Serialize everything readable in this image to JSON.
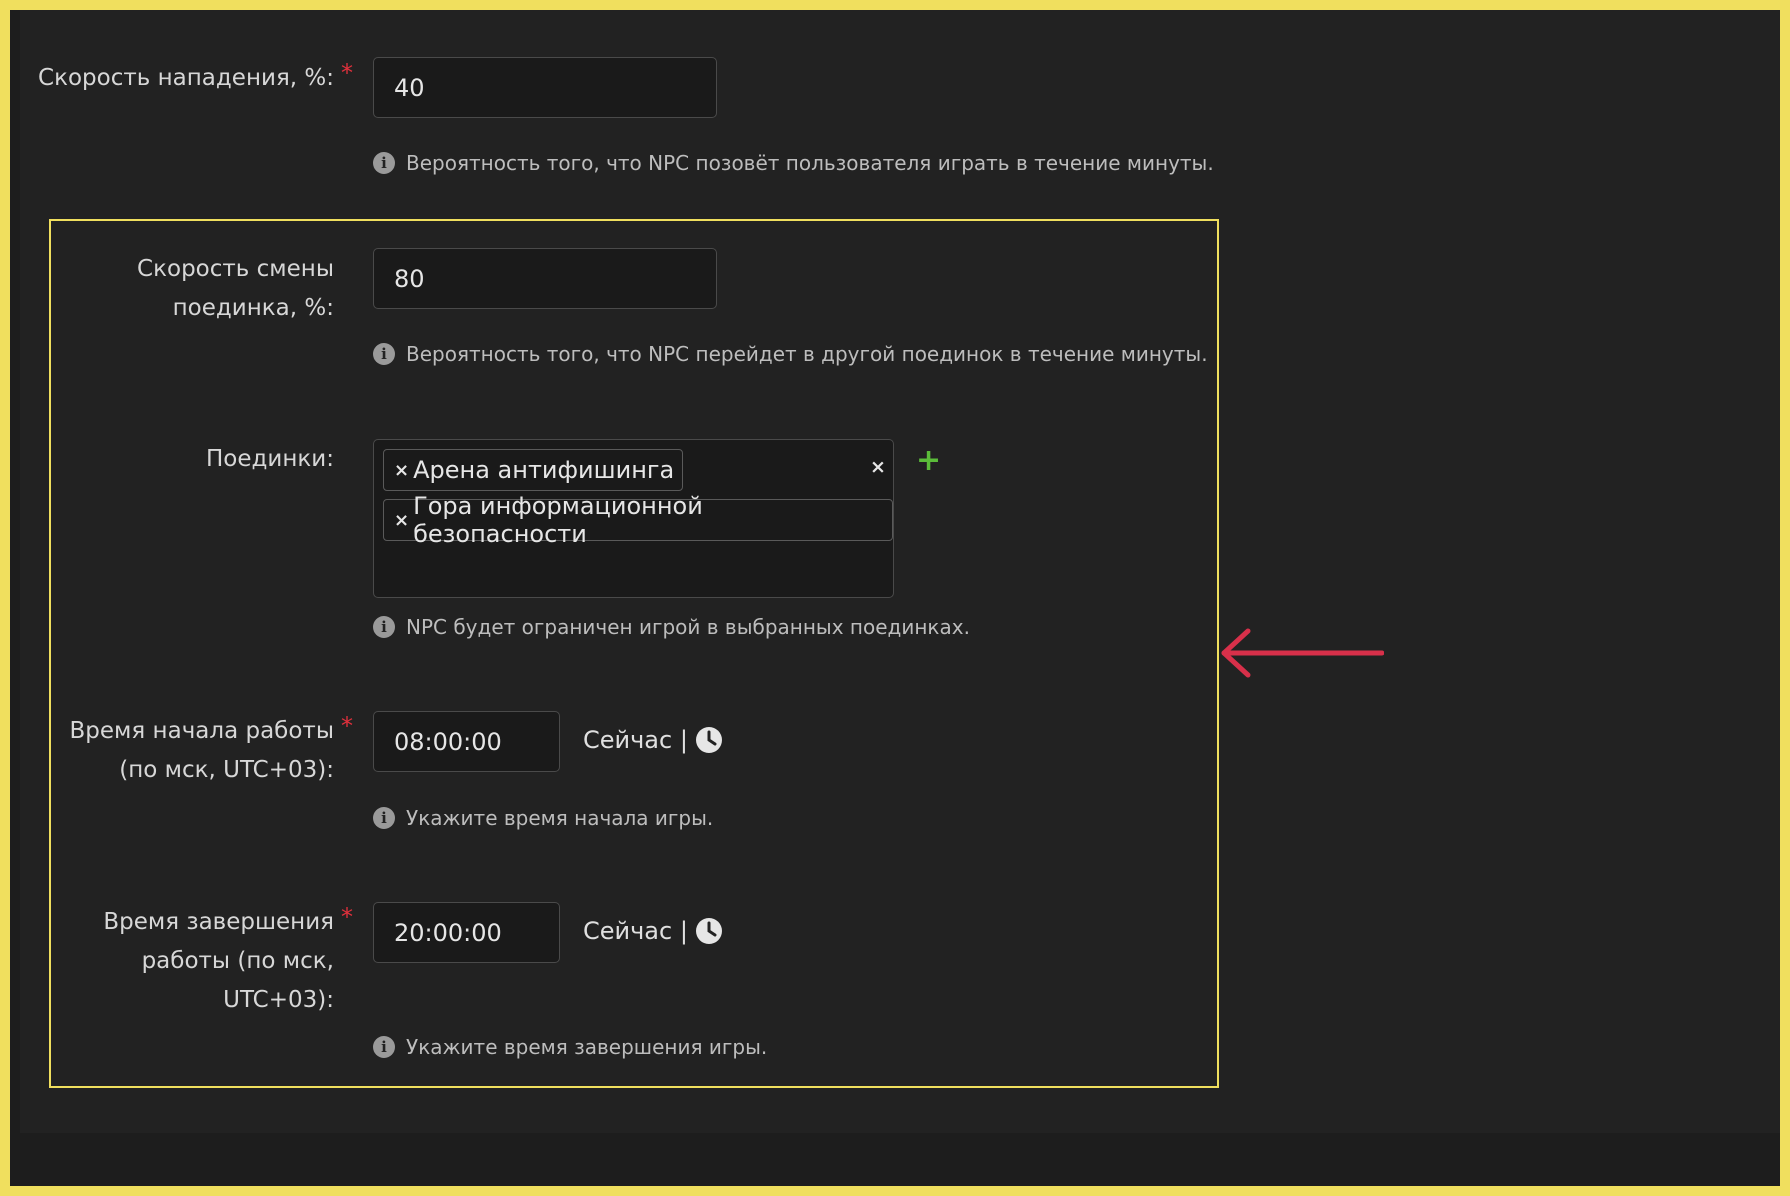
{
  "fields": {
    "attack_speed": {
      "label": "Скорость нападения, %:",
      "required_mark": "*",
      "value": "40",
      "hint": "Вероятность того, что NPC позовёт пользователя играть в течение минуты."
    },
    "duel_change_speed": {
      "label": "Скорость смены поединка, %:",
      "value": "80",
      "hint": "Вероятность того, что NPC перейдет в другой поединок в течение минуты."
    },
    "duels": {
      "label": "Поединки:",
      "tags": [
        "Арена антифишинга",
        "Гора информационной безопасности"
      ],
      "tag_remove_glyph": "×",
      "clear_glyph": "×",
      "add_glyph": "+",
      "hint": "NPC будет ограничен игрой в выбранных поединках."
    },
    "start_time": {
      "label": "Время начала работы (по мск, UTC+03):",
      "required_mark": "*",
      "value": "08:00:00",
      "now_label": "Сейчас |",
      "hint": "Укажите время начала игры."
    },
    "end_time": {
      "label": "Время завершения работы (по мск, UTC+03):",
      "required_mark": "*",
      "value": "20:00:00",
      "now_label": "Сейчас |",
      "hint": "Укажите время завершения игры."
    }
  },
  "icons": {
    "info": "info-icon",
    "clock": "clock-icon",
    "arrow": "arrow-left-icon"
  },
  "colors": {
    "frame": "#f0df5e",
    "required": "#e0303c",
    "add": "#5bbd3a",
    "arrow": "#d8304a"
  }
}
